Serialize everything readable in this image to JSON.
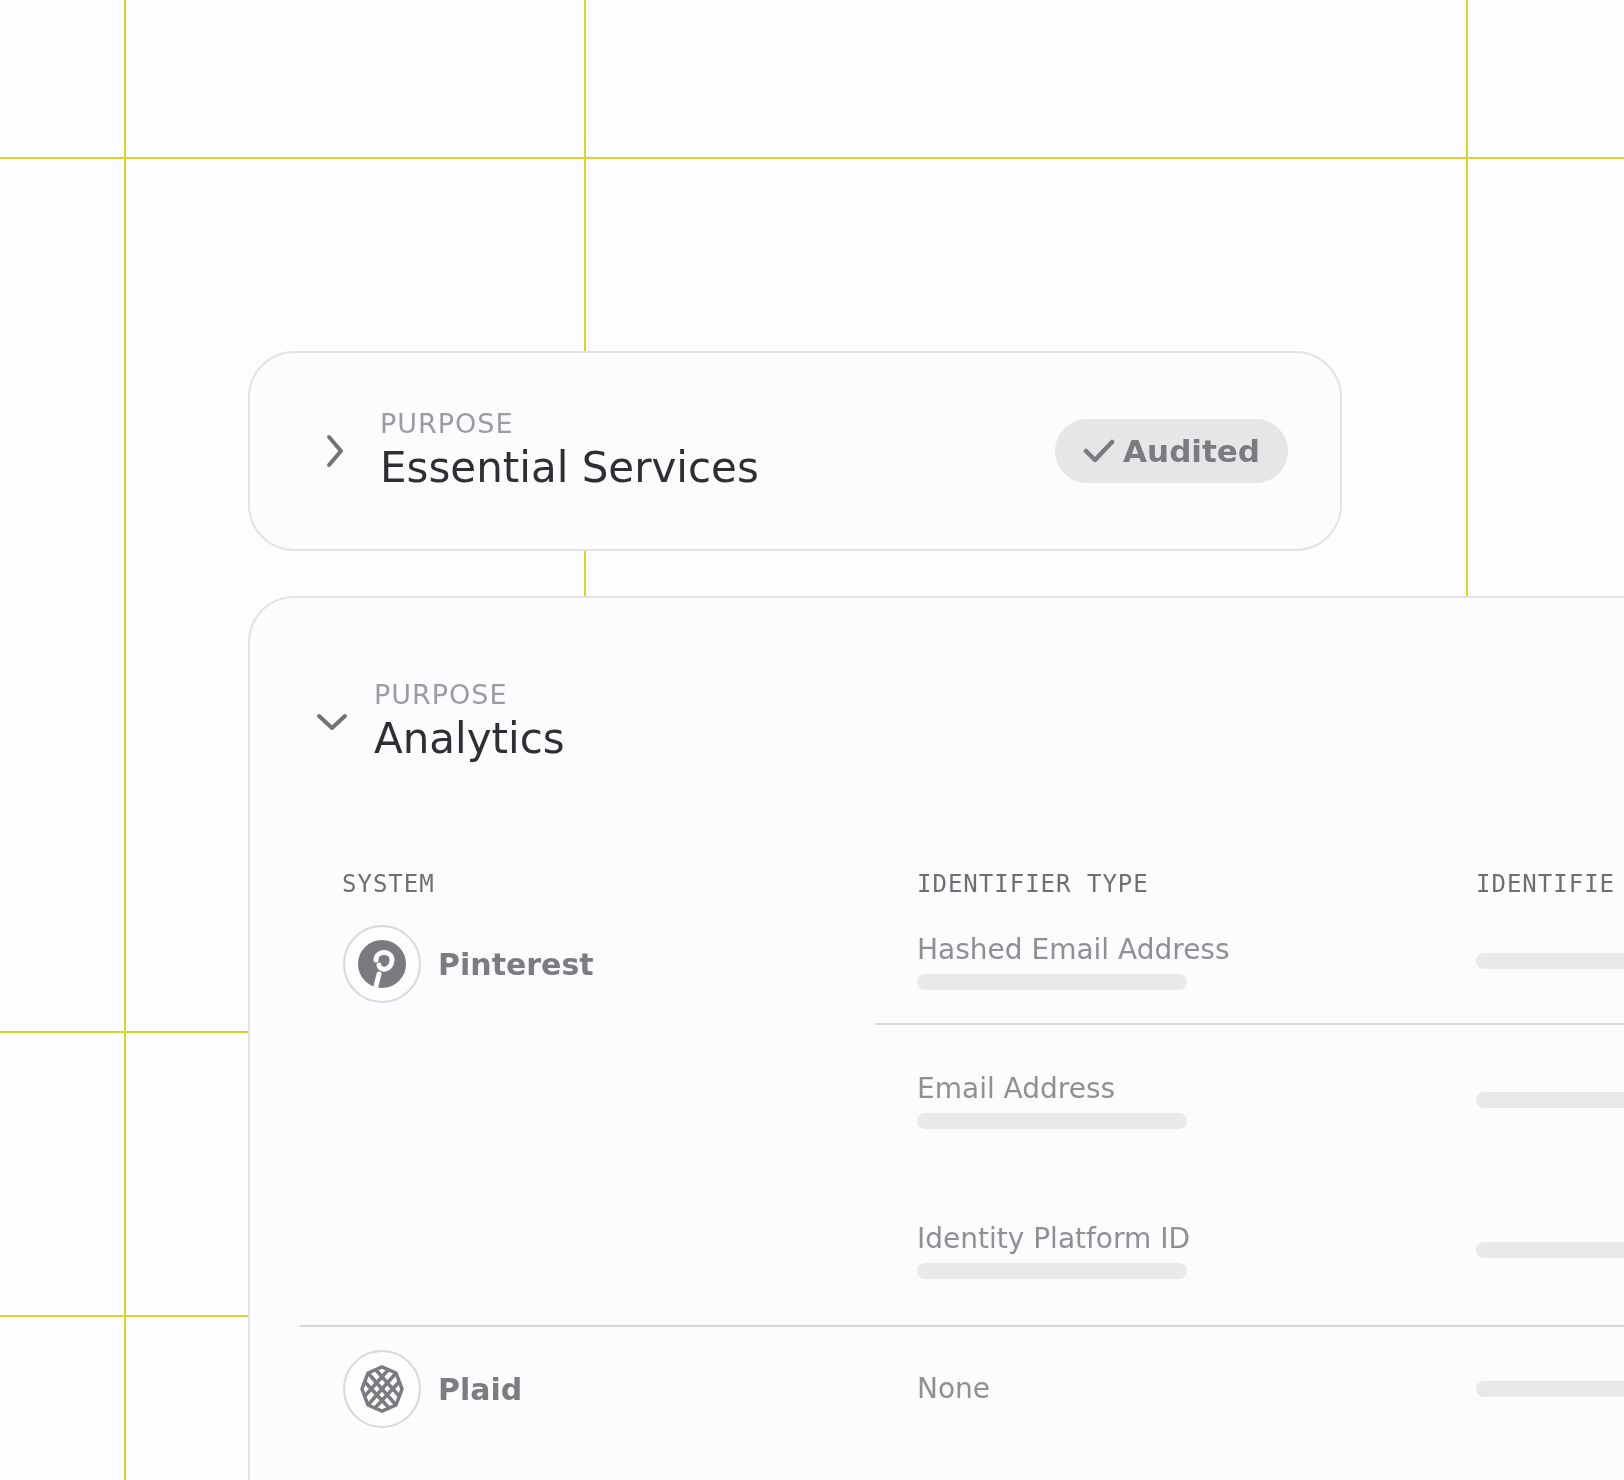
{
  "purposes": [
    {
      "label": "PURPOSE",
      "title": "Essential Services",
      "expanded": false,
      "badge": "Audited"
    },
    {
      "label": "PURPOSE",
      "title": "Analytics",
      "expanded": true
    }
  ],
  "table": {
    "columns": [
      "SYSTEM",
      "IDENTIFIER TYPE",
      "IDENTIFIE"
    ],
    "rows": [
      {
        "system": "Pinterest",
        "kind": "p-mark",
        "identifiers": [
          {
            "label": "Hashed Email Address",
            "kind": "skeleton"
          },
          {
            "label": "Email Address",
            "kind": "skeleton"
          },
          {
            "label": "Identity Platform ID",
            "kind": "skeleton"
          }
        ]
      },
      {
        "system": "Plaid",
        "kind": "lattice",
        "identifiers": [
          {
            "label": "None",
            "kind": "plain"
          }
        ]
      }
    ]
  }
}
